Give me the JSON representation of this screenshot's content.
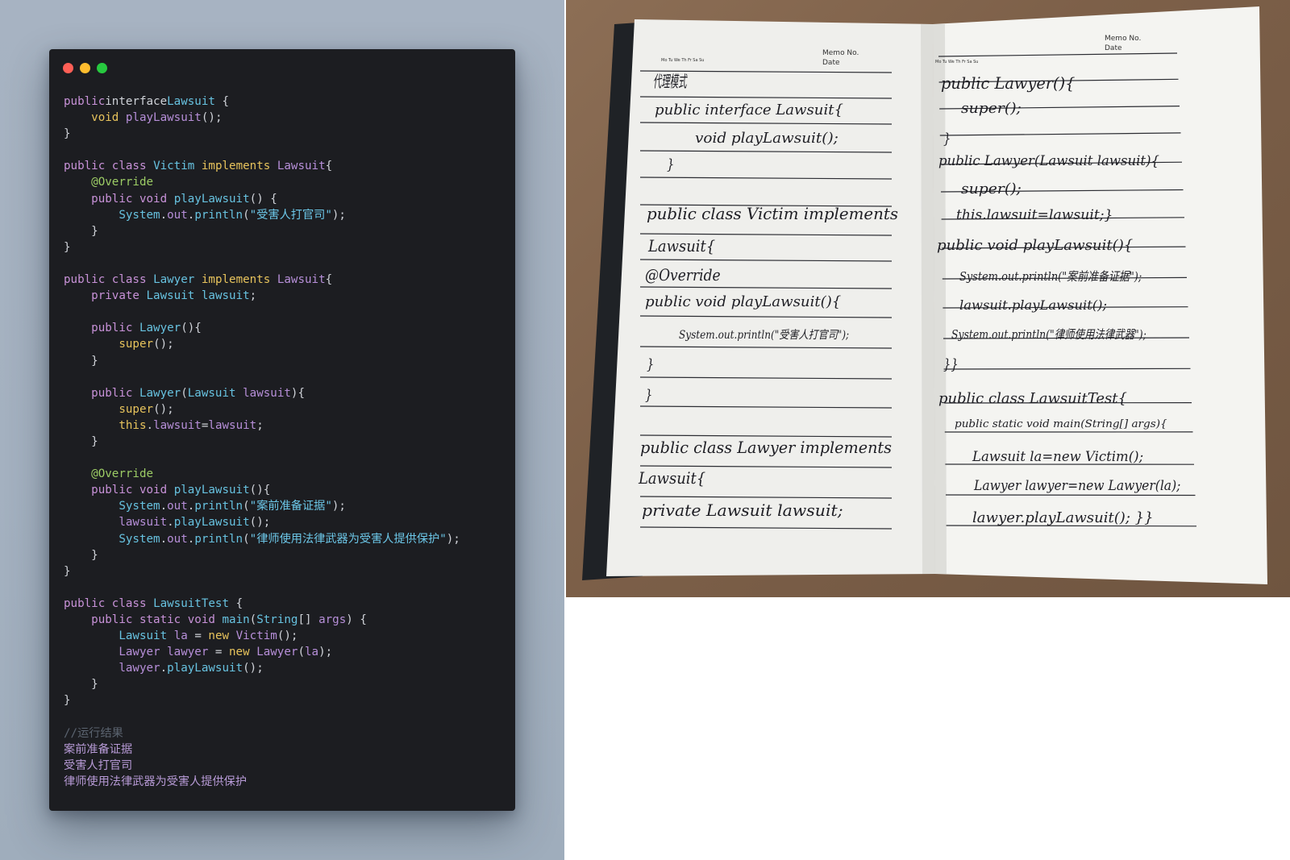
{
  "code_window": {
    "window_controls": [
      "close",
      "minimize",
      "maximize"
    ],
    "lines": [
      [
        [
          "kw",
          "public"
        ],
        [
          "",
          "interface"
        ],
        [
          "",
          ""
        ],
        [
          "ty",
          "Lawsuit"
        ],
        [
          "",
          " {"
        ]
      ],
      [
        [
          "",
          "    "
        ],
        [
          "kw2",
          "void"
        ],
        [
          "",
          " "
        ],
        [
          "var",
          "playLawsuit"
        ],
        [
          "",
          "();"
        ]
      ],
      [
        [
          "",
          "}"
        ]
      ],
      [
        [
          "",
          ""
        ]
      ],
      [
        [
          "kw",
          "public"
        ],
        [
          "",
          " "
        ],
        [
          "kw",
          "class"
        ],
        [
          "",
          " "
        ],
        [
          "ty",
          "Victim"
        ],
        [
          "",
          " "
        ],
        [
          "kw2",
          "implements"
        ],
        [
          "",
          " "
        ],
        [
          "var",
          "Lawsuit"
        ],
        [
          "",
          "{"
        ]
      ],
      [
        [
          "",
          "    "
        ],
        [
          "an",
          "@Override"
        ]
      ],
      [
        [
          "",
          "    "
        ],
        [
          "kw",
          "public"
        ],
        [
          "",
          " "
        ],
        [
          "kw",
          "void"
        ],
        [
          "",
          " "
        ],
        [
          "ty",
          "playLawsuit"
        ],
        [
          "",
          "() {"
        ]
      ],
      [
        [
          "",
          "        "
        ],
        [
          "ty",
          "System"
        ],
        [
          "",
          "."
        ],
        [
          "var",
          "out"
        ],
        [
          "",
          "."
        ],
        [
          "ty",
          "println"
        ],
        [
          "",
          "("
        ],
        [
          "str",
          "\"受害人打官司\""
        ],
        [
          "",
          ");"
        ]
      ],
      [
        [
          "",
          "    }"
        ]
      ],
      [
        [
          "",
          "}"
        ]
      ],
      [
        [
          "",
          ""
        ]
      ],
      [
        [
          "kw",
          "public"
        ],
        [
          "",
          " "
        ],
        [
          "kw",
          "class"
        ],
        [
          "",
          " "
        ],
        [
          "ty",
          "Lawyer"
        ],
        [
          "",
          " "
        ],
        [
          "kw2",
          "implements"
        ],
        [
          "",
          " "
        ],
        [
          "var",
          "Lawsuit"
        ],
        [
          "",
          "{"
        ]
      ],
      [
        [
          "",
          "    "
        ],
        [
          "kw",
          "private"
        ],
        [
          "",
          " "
        ],
        [
          "ty",
          "Lawsuit"
        ],
        [
          "",
          " "
        ],
        [
          "ty",
          "lawsuit"
        ],
        [
          "",
          ";"
        ]
      ],
      [
        [
          "",
          ""
        ]
      ],
      [
        [
          "",
          "    "
        ],
        [
          "kw",
          "public"
        ],
        [
          "",
          " "
        ],
        [
          "ty",
          "Lawyer"
        ],
        [
          "",
          "(){"
        ]
      ],
      [
        [
          "",
          "        "
        ],
        [
          "kw2",
          "super"
        ],
        [
          "",
          "();"
        ]
      ],
      [
        [
          "",
          "    }"
        ]
      ],
      [
        [
          "",
          ""
        ]
      ],
      [
        [
          "",
          "    "
        ],
        [
          "kw",
          "public"
        ],
        [
          "",
          " "
        ],
        [
          "ty",
          "Lawyer"
        ],
        [
          "",
          "("
        ],
        [
          "ty",
          "Lawsuit"
        ],
        [
          "",
          " "
        ],
        [
          "var",
          "lawsuit"
        ],
        [
          "",
          "){"
        ]
      ],
      [
        [
          "",
          "        "
        ],
        [
          "kw2",
          "super"
        ],
        [
          "",
          "();"
        ]
      ],
      [
        [
          "",
          "        "
        ],
        [
          "kw2",
          "this"
        ],
        [
          "",
          "."
        ],
        [
          "var",
          "lawsuit"
        ],
        [
          "",
          "="
        ],
        [
          "var",
          "lawsuit"
        ],
        [
          "",
          ";"
        ]
      ],
      [
        [
          "",
          "    }"
        ]
      ],
      [
        [
          "",
          ""
        ]
      ],
      [
        [
          "",
          "    "
        ],
        [
          "an",
          "@Override"
        ]
      ],
      [
        [
          "",
          "    "
        ],
        [
          "kw",
          "public"
        ],
        [
          "",
          " "
        ],
        [
          "kw",
          "void"
        ],
        [
          "",
          " "
        ],
        [
          "ty",
          "playLawsuit"
        ],
        [
          "",
          "(){"
        ]
      ],
      [
        [
          "",
          "        "
        ],
        [
          "ty",
          "System"
        ],
        [
          "",
          "."
        ],
        [
          "var",
          "out"
        ],
        [
          "",
          "."
        ],
        [
          "ty",
          "println"
        ],
        [
          "",
          "("
        ],
        [
          "str",
          "\"案前准备证据\""
        ],
        [
          "",
          ");"
        ]
      ],
      [
        [
          "",
          "        "
        ],
        [
          "var",
          "lawsuit"
        ],
        [
          "",
          "."
        ],
        [
          "ty",
          "playLawsuit"
        ],
        [
          "",
          "();"
        ]
      ],
      [
        [
          "",
          "        "
        ],
        [
          "ty",
          "System"
        ],
        [
          "",
          "."
        ],
        [
          "var",
          "out"
        ],
        [
          "",
          "."
        ],
        [
          "ty",
          "println"
        ],
        [
          "",
          "("
        ],
        [
          "str",
          "\"律师使用法律武器为受害人提供保护\""
        ],
        [
          "",
          ");"
        ]
      ],
      [
        [
          "",
          "    }"
        ]
      ],
      [
        [
          "",
          "}"
        ]
      ],
      [
        [
          "",
          ""
        ]
      ],
      [
        [
          "kw",
          "public"
        ],
        [
          "",
          " "
        ],
        [
          "kw",
          "class"
        ],
        [
          "",
          " "
        ],
        [
          "ty",
          "LawsuitTest"
        ],
        [
          "",
          " {"
        ]
      ],
      [
        [
          "",
          "    "
        ],
        [
          "kw",
          "public"
        ],
        [
          "",
          " "
        ],
        [
          "kw",
          "static"
        ],
        [
          "",
          " "
        ],
        [
          "kw",
          "void"
        ],
        [
          "",
          " "
        ],
        [
          "ty",
          "main"
        ],
        [
          "",
          "("
        ],
        [
          "ty",
          "String"
        ],
        [
          "",
          "[] "
        ],
        [
          "var",
          "args"
        ],
        [
          "",
          ") {"
        ]
      ],
      [
        [
          "",
          "        "
        ],
        [
          "ty",
          "Lawsuit"
        ],
        [
          "",
          " "
        ],
        [
          "var",
          "la"
        ],
        [
          "",
          " = "
        ],
        [
          "kw2",
          "new"
        ],
        [
          "",
          " "
        ],
        [
          "var",
          "Victim"
        ],
        [
          "",
          "();"
        ]
      ],
      [
        [
          "",
          "        "
        ],
        [
          "var",
          "Lawyer"
        ],
        [
          "",
          " "
        ],
        [
          "var",
          "lawyer"
        ],
        [
          "",
          " = "
        ],
        [
          "kw2",
          "new"
        ],
        [
          "",
          " "
        ],
        [
          "var",
          "Lawyer"
        ],
        [
          "",
          "("
        ],
        [
          "var",
          "la"
        ],
        [
          "",
          ");"
        ]
      ],
      [
        [
          "",
          "        "
        ],
        [
          "var",
          "lawyer"
        ],
        [
          "",
          "."
        ],
        [
          "ty",
          "playLawsuit"
        ],
        [
          "",
          "();"
        ]
      ],
      [
        [
          "",
          "    }"
        ]
      ],
      [
        [
          "",
          "}"
        ]
      ],
      [
        [
          "",
          ""
        ]
      ],
      [
        [
          "cm",
          "//运行结果"
        ]
      ],
      [
        [
          "out",
          "案前准备证据"
        ]
      ],
      [
        [
          "out",
          "受害人打官司"
        ]
      ],
      [
        [
          "out",
          "律师使用法律武器为受害人提供保护"
        ]
      ]
    ]
  },
  "notebook": {
    "header_left": {
      "memo": "Memo No.",
      "date": "Date",
      "days": "Mo Tu We Th Fr Sa Su"
    },
    "header_right": {
      "memo": "Memo No.",
      "date": "Date",
      "days": "Mo Tu We Th Fr Sa Su"
    },
    "left_page": [
      "代理模式",
      "public interface Lawsuit{",
      "void playLawsuit();",
      "}",
      "",
      "public class Victim implements",
      "Lawsuit{",
      "@Override",
      "public void playLawsuit(){",
      "System.out.println(\"受害人打官司\");",
      "}",
      "}",
      "",
      "public class Lawyer implements",
      "Lawsuit{",
      "private Lawsuit lawsuit;"
    ],
    "right_page": [
      "public Lawyer(){",
      "super();",
      "}",
      "public Lawyer(Lawsuit lawsuit){",
      "super();",
      "this.lawsuit=lawsuit;}",
      "public void playLawsuit(){",
      "System.out.println(\"案前准备证据\");",
      "lawsuit.playLawsuit();",
      "System.out.println(\"律师使用法律武器\");",
      "}}",
      "public class LawsuitTest{",
      "public static void main(String[] args){",
      "Lawsuit la=new Victim();",
      "Lawyer lawyer=new Lawyer(la);",
      "lawyer.playLawsuit(); }}"
    ]
  }
}
